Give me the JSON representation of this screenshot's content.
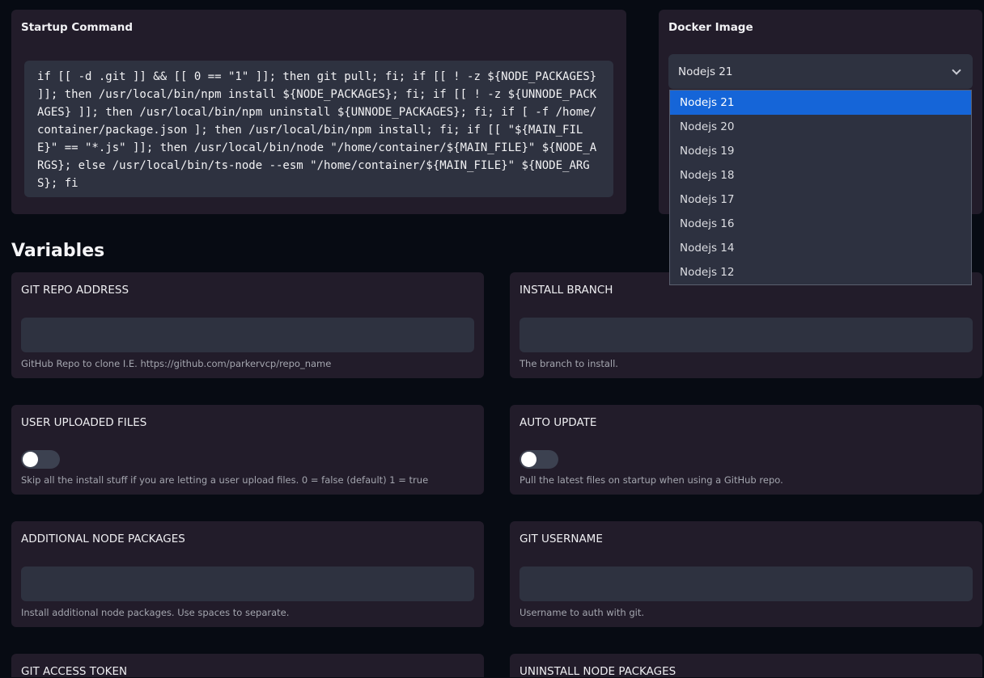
{
  "startup": {
    "title": "Startup Command",
    "command": "if [[ -d .git ]] && [[ 0 == \"1\" ]]; then git pull; fi; if [[ ! -z ${NODE_PACKAGES} ]]; then /usr/local/bin/npm install ${NODE_PACKAGES}; fi; if [[ ! -z ${UNNODE_PACKAGES} ]]; then /usr/local/bin/npm uninstall ${UNNODE_PACKAGES}; fi; if [ -f /home/container/package.json ]; then /usr/local/bin/npm install; fi; if [[ \"${MAIN_FILE}\" == \"*.js\" ]]; then /usr/local/bin/node \"/home/container/${MAIN_FILE}\" ${NODE_ARGS}; else /usr/local/bin/ts-node --esm \"/home/container/${MAIN_FILE}\" ${NODE_ARGS}; fi"
  },
  "docker": {
    "title": "Docker Image",
    "selected": "Nodejs 21",
    "options": [
      "Nodejs 21",
      "Nodejs 20",
      "Nodejs 19",
      "Nodejs 18",
      "Nodejs 17",
      "Nodejs 16",
      "Nodejs 14",
      "Nodejs 12"
    ]
  },
  "variables": {
    "title": "Variables",
    "git_repo": {
      "label": "GIT REPO ADDRESS",
      "value": "",
      "description": "GitHub Repo to clone I.E. https://github.com/parkervcp/repo_name"
    },
    "install_branch": {
      "label": "INSTALL BRANCH",
      "value": "",
      "description": "The branch to install."
    },
    "user_uploaded": {
      "label": "USER UPLOADED FILES",
      "enabled": false,
      "description": "Skip all the install stuff if you are letting a user upload files. 0 = false (default) 1 = true"
    },
    "auto_update": {
      "label": "AUTO UPDATE",
      "enabled": false,
      "description": "Pull the latest files on startup when using a GitHub repo."
    },
    "node_packages": {
      "label": "ADDITIONAL NODE PACKAGES",
      "value": "",
      "description": "Install additional node packages. Use spaces to separate."
    },
    "git_username": {
      "label": "GIT USERNAME",
      "value": "",
      "description": "Username to auth with git."
    },
    "git_token": {
      "label": "GIT ACCESS TOKEN"
    },
    "uninstall_packages": {
      "label": "UNINSTALL NODE PACKAGES"
    }
  }
}
